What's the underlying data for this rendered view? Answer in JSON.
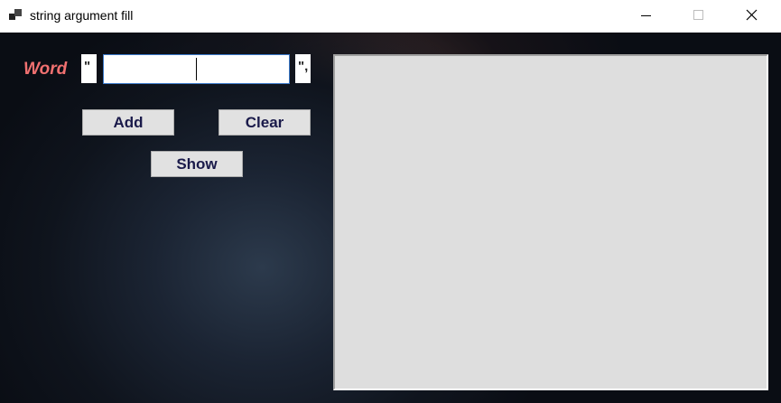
{
  "window": {
    "title": "string argument fill",
    "app_icon": "app-window-icon"
  },
  "title_buttons": {
    "minimize_icon": "minimize-icon",
    "maximize_icon": "maximize-icon",
    "close_icon": "close-icon"
  },
  "form": {
    "word_label": "Word",
    "quote_open": "\"",
    "quote_close": "\",",
    "word_input_value": "",
    "add_label": "Add",
    "clear_label": "Clear",
    "show_label": "Show",
    "output_text": ""
  },
  "colors": {
    "label_accent": "#f07070",
    "button_text": "#1a1a4a",
    "output_background": "#dedede"
  }
}
